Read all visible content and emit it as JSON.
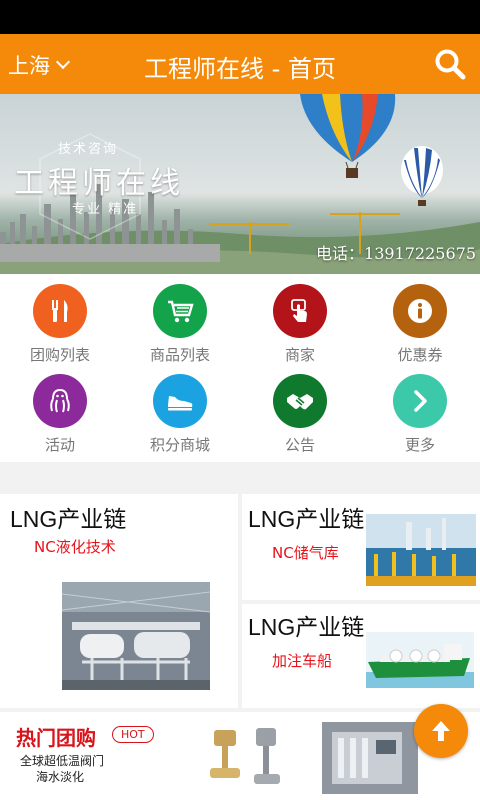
{
  "header": {
    "city": "上海",
    "title": "工程师在线 - 首页"
  },
  "banner": {
    "small": "技术咨询",
    "big": "工程师在线",
    "tag": "专业 精准",
    "phone": "电话：13917225675"
  },
  "grid": [
    {
      "label": "团购列表",
      "color": "#f0611f",
      "icon": "fork-knife-icon"
    },
    {
      "label": "商品列表",
      "color": "#13a34a",
      "icon": "cart-icon"
    },
    {
      "label": "商家",
      "color": "#b3141a",
      "icon": "touch-icon"
    },
    {
      "label": "优惠券",
      "color": "#b5620f",
      "icon": "info-icon"
    },
    {
      "label": "活动",
      "color": "#8c2a9b",
      "icon": "octopus-icon"
    },
    {
      "label": "积分商城",
      "color": "#1aa3e0",
      "icon": "shoe-icon"
    },
    {
      "label": "公告",
      "color": "#0f7a2d",
      "icon": "handshake-icon"
    },
    {
      "label": "更多",
      "color": "#3cc9a9",
      "icon": "chevron-right-icon"
    }
  ],
  "promo": {
    "left": {
      "title": "LNG产业链",
      "subtitle": "NC液化技术"
    },
    "right_top": {
      "title": "LNG产业链",
      "subtitle": "NC储气库"
    },
    "right_bottom": {
      "title": "LNG产业链",
      "subtitle": "加注车船"
    }
  },
  "hot": {
    "title": "热门团购",
    "badge": "HOT",
    "line1": "全球超低温阀门",
    "line2": "海水淡化"
  },
  "colors": {
    "accent": "#f58a0a",
    "red": "#e8131a"
  }
}
